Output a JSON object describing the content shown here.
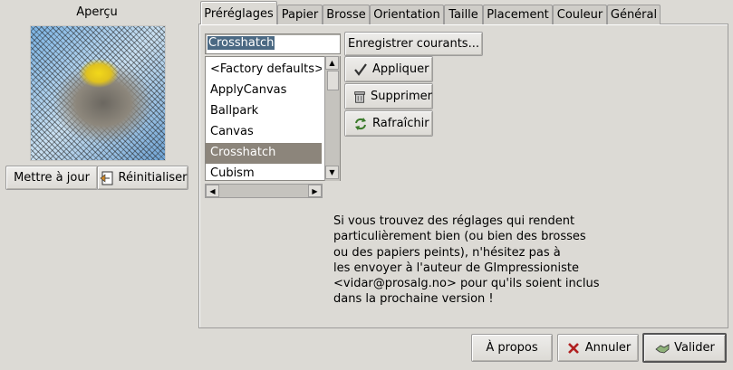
{
  "preview": {
    "title": "Aperçu",
    "update_label": "Mettre à jour",
    "reset_label": "Réinitialiser"
  },
  "tabs": [
    {
      "label": "Préréglages",
      "mnemonic": "P"
    },
    {
      "label": "Papier",
      "mnemonic": "P"
    },
    {
      "label": "Brosse",
      "mnemonic": "B"
    },
    {
      "label": "Orientation",
      "mnemonic": "O"
    },
    {
      "label": "Taille",
      "mnemonic": "T"
    },
    {
      "label": "Placement",
      "mnemonic": "m"
    },
    {
      "label": "Couleur",
      "mnemonic": "C"
    },
    {
      "label": "Général",
      "mnemonic": "G"
    }
  ],
  "presets": {
    "entry_value": "Crosshatch",
    "save_current_label": "Enregistrer courants...",
    "apply_label": "Appliquer",
    "delete_label": "Supprimer",
    "refresh_label": "Rafraîchir",
    "items": [
      "<Factory defaults>",
      "ApplyCanvas",
      "Ballpark",
      "Canvas",
      "Crosshatch",
      "Cubism"
    ],
    "selected": "Crosshatch"
  },
  "info": {
    "lines": [
      "Si vous trouvez des réglages qui rendent",
      "particulièrement bien (ou bien des brosses",
      "ou des papiers peints), n'hésitez pas à",
      "les envoyer à l'auteur de GImpressioniste",
      "<vidar@prosalg.no> pour qu'ils soient inclus",
      "dans la prochaine version !"
    ]
  },
  "footer": {
    "about_label": "À propos",
    "cancel_label": "Annuler",
    "ok_label": "Valider"
  },
  "colors": {
    "background": "#dcdad5",
    "selection": "#4b6983",
    "list_selection": "#8c857b"
  }
}
